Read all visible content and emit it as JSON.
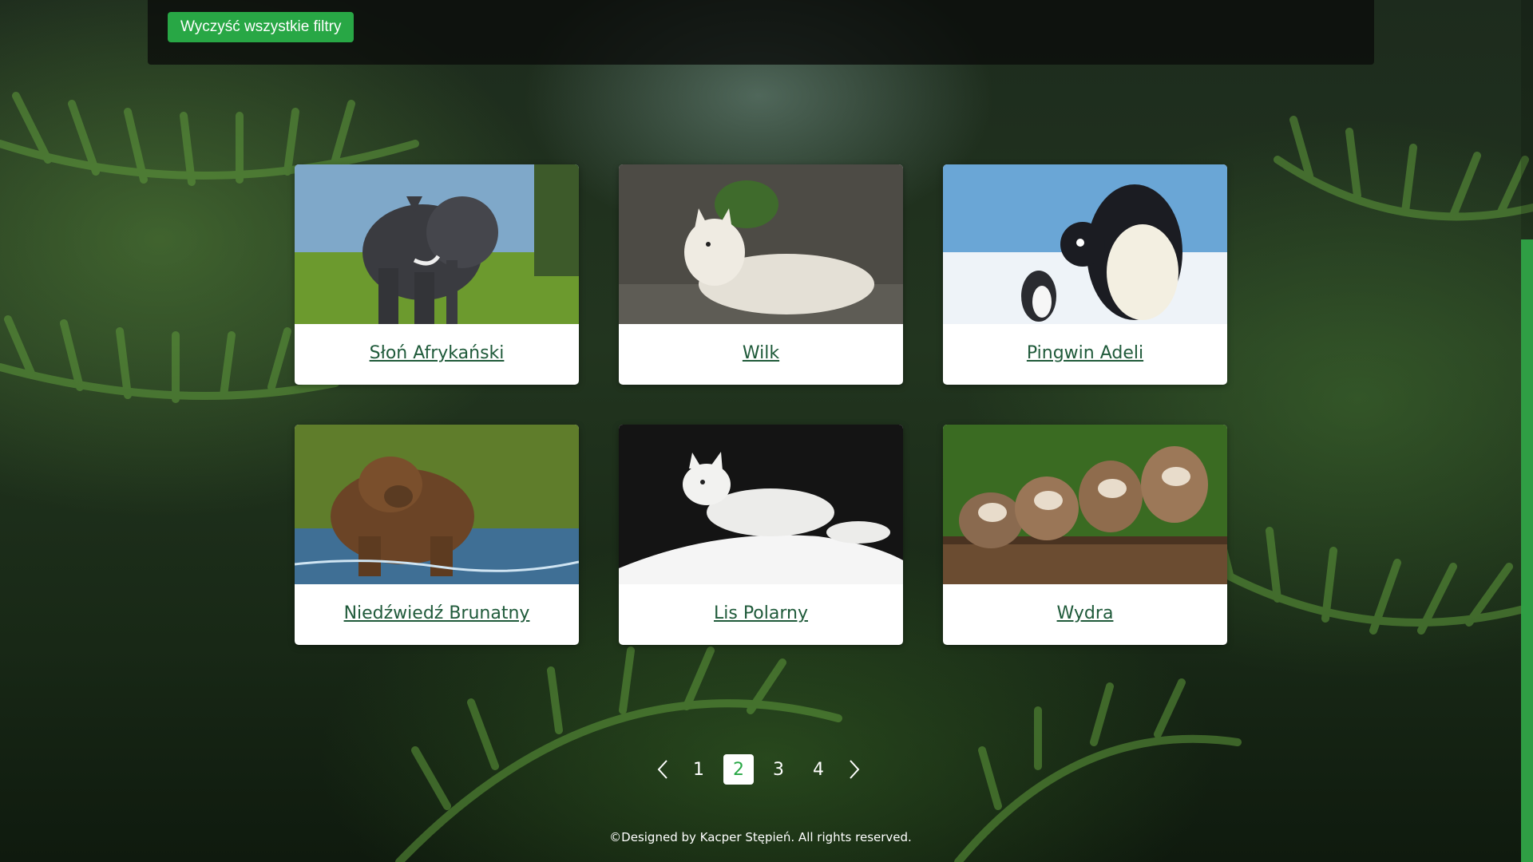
{
  "filters": {
    "clear_all_label": "Wyczyść wszystkie filtry"
  },
  "animals": [
    {
      "name": "Słoń Afrykański",
      "image": "elephant-photo"
    },
    {
      "name": "Wilk",
      "image": "wolf-photo"
    },
    {
      "name": "Pingwin Adeli",
      "image": "penguin-photo"
    },
    {
      "name": "Niedźwiedź Brunatny",
      "image": "bear-photo"
    },
    {
      "name": "Lis Polarny",
      "image": "arctic-fox-photo"
    },
    {
      "name": "Wydra",
      "image": "otter-photo"
    }
  ],
  "pagination": {
    "prev_icon": "chevron-left-icon",
    "next_icon": "chevron-right-icon",
    "pages": [
      "1",
      "2",
      "3",
      "4"
    ],
    "current_page": "2"
  },
  "footer": {
    "text": "©Designed by Kacper Stępień. All rights reserved."
  },
  "colors": {
    "accent": "#28a745",
    "link": "#1f5a3a",
    "card_bg": "#ffffff"
  }
}
